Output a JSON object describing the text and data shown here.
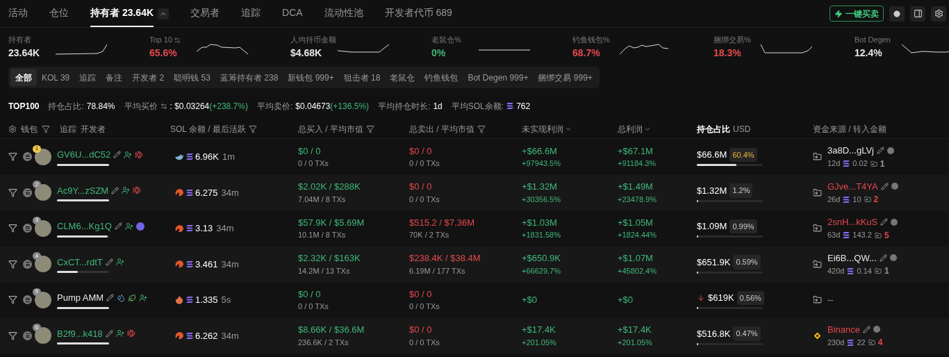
{
  "tabs": [
    {
      "label": "活动",
      "selected": false
    },
    {
      "label": "仓位",
      "selected": false
    },
    {
      "label": "持有者 23.64K",
      "selected": true,
      "expandable": true
    },
    {
      "label": "交易者",
      "selected": false
    },
    {
      "label": "追踪",
      "selected": false
    },
    {
      "label": "DCA",
      "selected": false
    },
    {
      "label": "流动性池",
      "selected": false
    },
    {
      "label": "开发者代币 689",
      "selected": false
    }
  ],
  "quick_trade_button": "一键买卖",
  "stats": [
    {
      "label": "持有者",
      "value": "23.64K",
      "color": "#e8e8e8"
    },
    {
      "label": "Top 10",
      "value": "65.6%",
      "color": "#e5484d",
      "swap": true
    },
    {
      "label": "人均持币金额",
      "value": "$4.68K",
      "color": "#e8e8e8"
    },
    {
      "label": "老鼠仓%",
      "value": "0%",
      "color": "#3fb879"
    },
    {
      "label": "钓鱼钱包%",
      "value": "68.7%",
      "color": "#e5484d"
    },
    {
      "label": "捆绑交易%",
      "value": "18.3%",
      "color": "#e5484d"
    },
    {
      "label": "Bot Degen",
      "value": "12.4%",
      "color": "#e8e8e8"
    }
  ],
  "filters": [
    {
      "label": "全部",
      "selected": true
    },
    {
      "label": "KOL 39",
      "selected": false
    },
    {
      "label": "追踪",
      "selected": false
    },
    {
      "label": "备注",
      "selected": false
    },
    {
      "label": "开发者 2",
      "selected": false
    },
    {
      "label": "聪明钱 53",
      "selected": false
    },
    {
      "label": "蓝筹持有者 238",
      "selected": false
    },
    {
      "label": "新钱包 999+",
      "selected": false
    },
    {
      "label": "狙击者 18",
      "selected": false
    },
    {
      "label": "老鼠仓",
      "selected": false
    },
    {
      "label": "钓鱼钱包",
      "selected": false
    },
    {
      "label": "Bot Degen 999+",
      "selected": false
    },
    {
      "label": "捆绑交易 999+",
      "selected": false
    }
  ],
  "summary": {
    "title": "TOP100",
    "items": [
      {
        "label": "持仓占比:",
        "value": "78.84%"
      },
      {
        "label": "平均买价",
        "swap": true,
        "value": ": $0.03264",
        "change": "(+238.7%)"
      },
      {
        "label": "平均卖价:",
        "value": "$0.04673",
        "change": "(+136.5%)"
      },
      {
        "label": "平均持仓时长:",
        "value": "1d"
      },
      {
        "label": "平均SOL余额:",
        "value": "762",
        "sol": true
      }
    ]
  },
  "columns": {
    "wallet": "钱包",
    "track": "追踪",
    "dev": "开发者",
    "balance": "SOL 余额 / 最后活跃",
    "buy": "总买入 / 平均市值",
    "sell": "总卖出 / 平均市值",
    "unrealized": "未实现利润",
    "total_profit": "总利润",
    "holding": "持仓占比",
    "currency": "USD",
    "source": "资金来源 / 转入金额"
  },
  "rows": [
    {
      "rank": "1",
      "wallet": {
        "address": "GV6U...dC52",
        "color": "#3fb879"
      },
      "wallet_bar": {
        "level": 1
      },
      "badges": [
        {
          "kind": "user"
        },
        {
          "kind": "fish"
        }
      ],
      "tier": {
        "kind": "whale"
      },
      "balance": "6.96K",
      "last_active": "1m",
      "buy": "$0 / 0",
      "buy_txs": "0 / 0 TXs",
      "sell": "$0 / 0",
      "sell_txs": "0 / 0 TXs",
      "unrealized": "+$66.6M",
      "unrealized_pct": "+97943.5%",
      "total": "+$67.1M",
      "total_pct": "+91184.3%",
      "holding": "$66.6M",
      "holding_pct": "60.4%",
      "highlight": true,
      "falling": false,
      "holding_bar": {
        "level": 0.6
      },
      "source": {
        "kind": "transfer",
        "name": "3a8D...gLVj",
        "color": "#e8e8e8",
        "age": "12d",
        "sol": "0.02",
        "transfers": {
          "count": "1",
          "color": "#9a9a9a"
        }
      }
    },
    {
      "rank": "2",
      "wallet": {
        "address": "Ac9Y...zSZM",
        "color": "#3fb879"
      },
      "wallet_bar": {
        "level": 1
      },
      "badges": [
        {
          "kind": "user"
        },
        {
          "kind": "fish"
        }
      ],
      "tier": {
        "kind": "shrimp"
      },
      "balance": "6.275",
      "last_active": "34m",
      "buy": "$2.02K / $288K",
      "buy_txs": "7.04M / 8 TXs",
      "sell": "$0 / 0",
      "sell_txs": "0 / 0 TXs",
      "unrealized": "+$1.32M",
      "unrealized_pct": "+30356.5%",
      "total": "+$1.49M",
      "total_pct": "+23478.9%",
      "holding": "$1.32M",
      "holding_pct": "1.2%",
      "highlight": false,
      "falling": false,
      "holding_bar": {
        "level": 0.012
      },
      "source": {
        "kind": "transfer",
        "name": "GJve...T4YA",
        "color": "#e5484d",
        "age": "26d",
        "sol": "10",
        "transfers": {
          "count": "2",
          "color": "#e5484d"
        }
      }
    },
    {
      "rank": "3",
      "wallet": {
        "address": "CLM6...Kg1Q",
        "color": "#3fb879"
      },
      "wallet_bar": {
        "level": 0.97
      },
      "badges": [
        {
          "kind": "user"
        },
        {
          "kind": "blob"
        }
      ],
      "tier": {
        "kind": "shrimp"
      },
      "balance": "3.13",
      "last_active": "34m",
      "buy": "$57.9K / $5.69M",
      "buy_txs": "10.1M / 8 TXs",
      "sell": "$515.2 / $7.36M",
      "sell_txs": "70K / 2 TXs",
      "unrealized": "+$1.03M",
      "unrealized_pct": "+1831.58%",
      "total": "+$1.05M",
      "total_pct": "+1824.44%",
      "holding": "$1.09M",
      "holding_pct": "0.99%",
      "highlight": false,
      "falling": false,
      "holding_bar": {
        "level": 0.01
      },
      "source": {
        "kind": "transfer",
        "name": "2snH...kKuS",
        "color": "#e5484d",
        "age": "63d",
        "sol": "143.2",
        "transfers": {
          "count": "5",
          "color": "#e5484d"
        }
      }
    },
    {
      "rank": "4",
      "wallet": {
        "address": "CxCT...rdtT",
        "color": "#3fb879"
      },
      "wallet_bar": {
        "level": 0.4
      },
      "badges": [
        {
          "kind": "user"
        }
      ],
      "tier": {
        "kind": "shrimp"
      },
      "balance": "3.461",
      "last_active": "34m",
      "buy": "$2.32K / $163K",
      "buy_txs": "14.2M / 13 TXs",
      "sell": "$238.4K / $38.4M",
      "sell_txs": "6.19M / 177 TXs",
      "unrealized": "+$650.9K",
      "unrealized_pct": "+66629.7%",
      "total": "+$1.07M",
      "total_pct": "+45802.4%",
      "holding": "$651.9K",
      "holding_pct": "0.59%",
      "highlight": false,
      "falling": false,
      "holding_bar": {
        "level": 0.006
      },
      "source": {
        "kind": "transfer",
        "name": "Ei6B...QW...",
        "color": "#e8e8e8",
        "age": "420d",
        "sol": "0.14",
        "transfers": {
          "count": "1",
          "color": "#9a9a9a"
        }
      }
    },
    {
      "rank": "5",
      "wallet": {
        "address": "Pump AMM",
        "color": "#e8e8e8"
      },
      "wallet_bar": {
        "level": 1
      },
      "badges": [
        {
          "kind": "drops"
        },
        {
          "kind": "leaf"
        },
        {
          "kind": "user"
        }
      ],
      "tier": {
        "kind": "fire"
      },
      "balance": "1.335",
      "last_active": "5s",
      "buy": "$0 / 0",
      "buy_txs": "0 / 0 TXs",
      "sell": "$0 / 0",
      "sell_txs": "0 / 0 TXs",
      "unrealized": "+$0",
      "total": "+$0",
      "holding": "$619K",
      "holding_pct": "0.56%",
      "highlight": false,
      "falling": true,
      "holding_bar": {
        "level": 0.006
      },
      "source": {
        "kind": "none",
        "name": "--"
      }
    },
    {
      "rank": "6",
      "wallet": {
        "address": "B2f9...k418",
        "color": "#3fb879"
      },
      "wallet_bar": {
        "level": 1
      },
      "badges": [
        {
          "kind": "user"
        },
        {
          "kind": "fish"
        }
      ],
      "tier": {
        "kind": "shrimp"
      },
      "balance": "6.262",
      "last_active": "34m",
      "buy": "$8.66K / $36.6M",
      "buy_txs": "236.6K / 2 TXs",
      "sell": "$0 / 0",
      "sell_txs": "0 / 0 TXs",
      "unrealized": "+$17.4K",
      "unrealized_pct": "+201.05%",
      "total": "+$17.4K",
      "total_pct": "+201.05%",
      "holding": "$516.8K",
      "holding_pct": "0.47%",
      "highlight": false,
      "falling": false,
      "holding_bar": {
        "level": 0.005
      },
      "source": {
        "kind": "exchange",
        "name": "Binance",
        "color": "#e5484d",
        "age": "230d",
        "sol": "22",
        "transfers": {
          "count": "4",
          "color": "#e5484d"
        }
      }
    }
  ]
}
